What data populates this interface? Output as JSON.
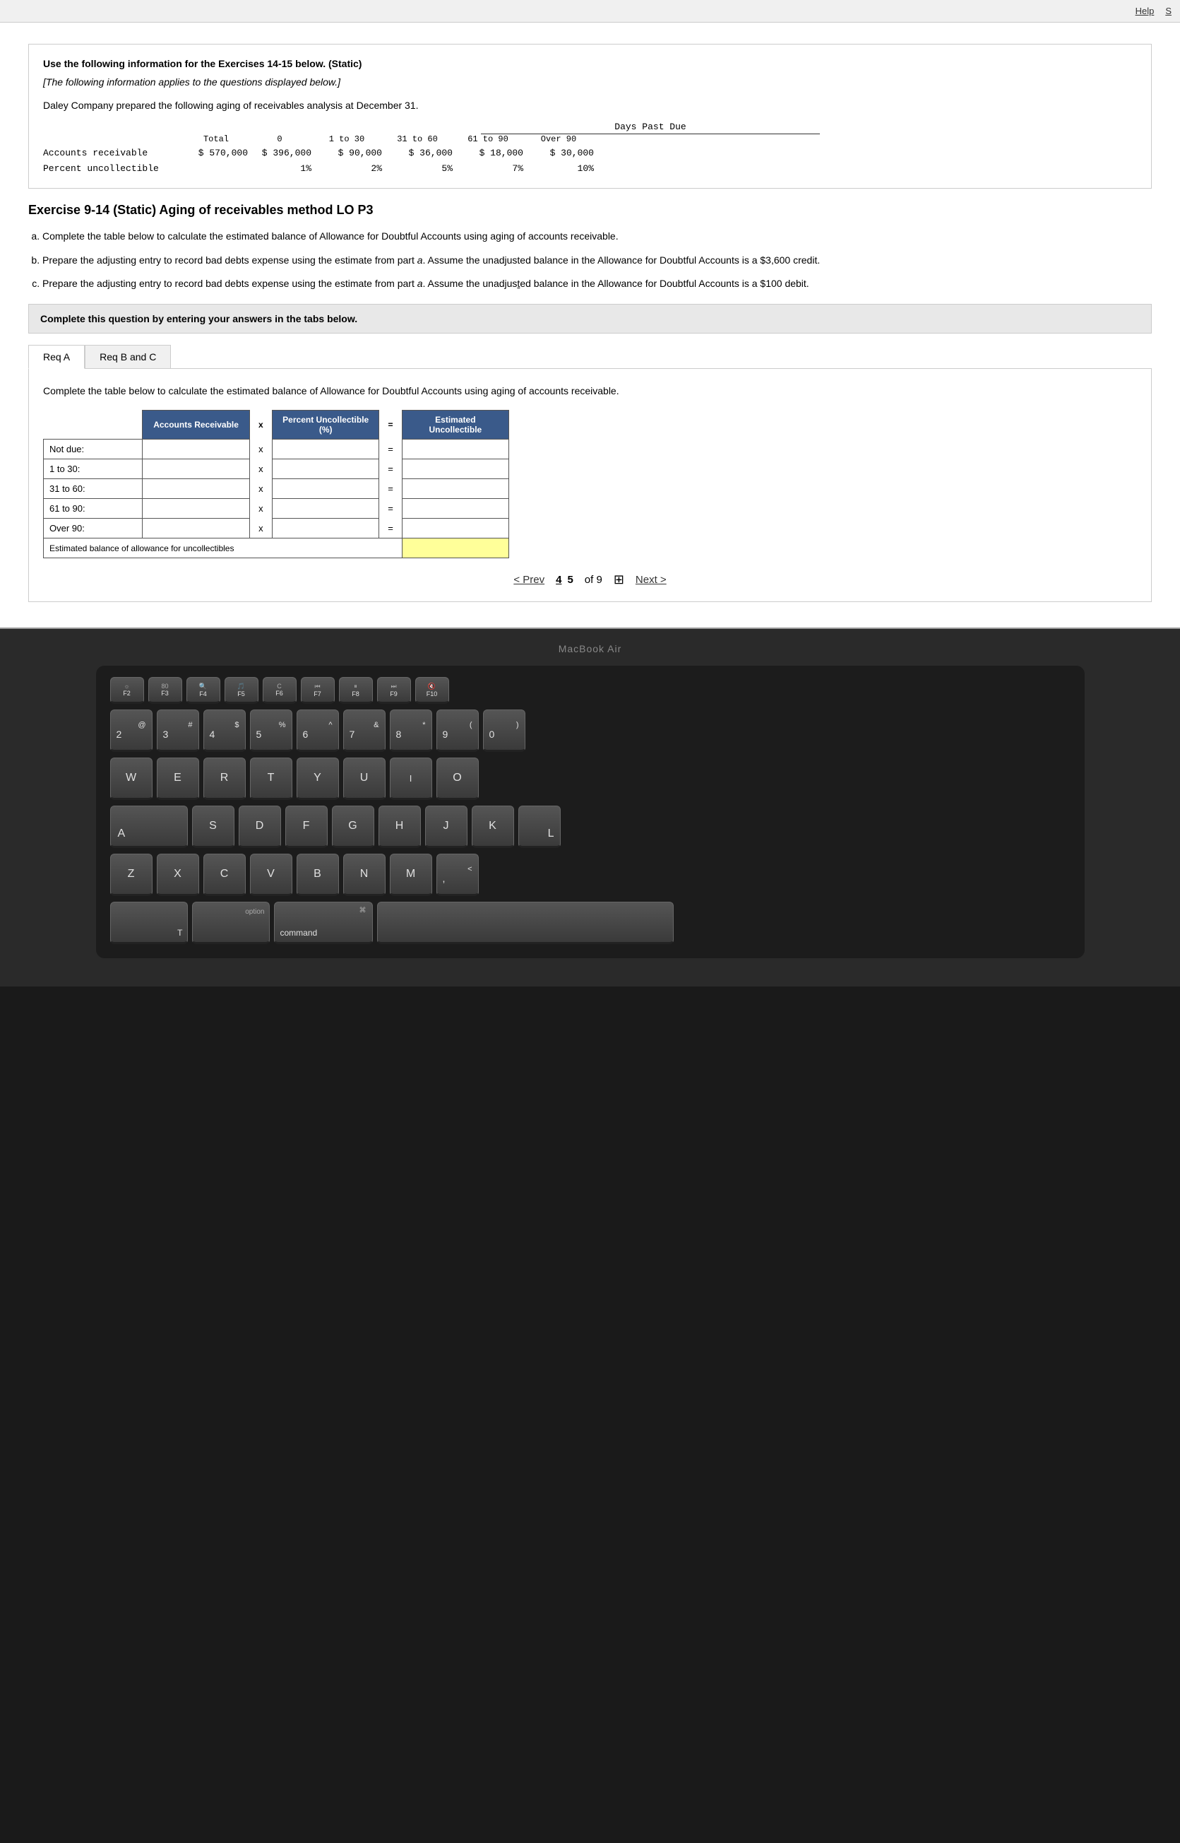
{
  "topbar": {
    "help_label": "Help",
    "s_label": "S"
  },
  "info_block": {
    "title": "Use the following information for the Exercises 14-15 below. (Static)",
    "subtitle": "[The following information applies to the questions displayed below.]",
    "description": "Daley Company prepared the following aging of receivables analysis at December 31.",
    "table": {
      "header": {
        "days_past_due": "Days Past Due",
        "total_label": "Total",
        "col0": "0",
        "col1": "1 to 30",
        "col2": "31 to 60",
        "col3": "61 to 90",
        "col4": "Over 90"
      },
      "row1_label": "Accounts receivable",
      "row1_total": "$ 570,000",
      "row1_0": "$ 396,000",
      "row1_1": "$ 90,000",
      "row1_2": "$ 36,000",
      "row1_3": "$ 18,000",
      "row1_4": "$ 30,000",
      "row2_label": "Percent uncollectible",
      "row2_0": "1%",
      "row2_1": "2%",
      "row2_2": "5%",
      "row2_3": "7%",
      "row2_4": "10%"
    }
  },
  "exercise": {
    "title": "Exercise 9-14 (Static) Aging of receivables method LO P3",
    "instructions": [
      "a. Complete the table below to calculate the estimated balance of Allowance for Doubtful Accounts using aging of accounts receivable.",
      "b. Prepare the adjusting entry to record bad debts expense using the estimate from part a. Assume the unadjusted balance in the Allowance for Doubtful Accounts is a $3,600 credit.",
      "c. Prepare the adjusting entry to record bad debts expense using the estimate from part a. Assume the unadjusted balance in the Allowance for Doubtful Accounts is a $100 debit."
    ],
    "complete_notice": "Complete this question by entering your answers in the tabs below.",
    "tabs": [
      {
        "label": "Req A",
        "active": true
      },
      {
        "label": "Req B and C",
        "active": false
      }
    ],
    "panel_intro": "Complete the table below to calculate the estimated balance of Allowance for Doubtful Accounts using aging of accounts receivable.",
    "table": {
      "headers": [
        "Accounts Receivable",
        "x",
        "Percent Uncollectible (%)",
        "=",
        "Estimated Uncollectible"
      ],
      "rows": [
        {
          "label": "Not due:",
          "accounts_receivable": "",
          "percent": "",
          "estimated": ""
        },
        {
          "label": "1 to 30:",
          "accounts_receivable": "",
          "percent": "",
          "estimated": ""
        },
        {
          "label": "31 to 60:",
          "accounts_receivable": "",
          "percent": "",
          "estimated": ""
        },
        {
          "label": "61 to 90:",
          "accounts_receivable": "",
          "percent": "",
          "estimated": ""
        },
        {
          "label": "Over 90:",
          "accounts_receivable": "",
          "percent": "",
          "estimated": ""
        }
      ],
      "footer_label": "Estimated balance of allowance for uncollectibles"
    }
  },
  "pagination": {
    "prev_label": "< Prev",
    "next_label": "Next >",
    "current_pages": "4  5",
    "of_label": "of 9"
  },
  "macbook_label": "MacBook Air",
  "keyboard": {
    "fn_row": [
      "F2",
      "F3 80",
      "F4 q",
      "F5 ♪",
      "F6 C",
      "F7 ◁◁",
      "F8 ▮▮",
      "F9 ▷▷",
      "F10 q"
    ],
    "row1": [
      {
        "top": "@",
        "bottom": "2"
      },
      {
        "top": "#",
        "bottom": "3"
      },
      {
        "top": "$",
        "bottom": "4"
      },
      {
        "top": "%",
        "bottom": "5"
      },
      {
        "top": "^",
        "bottom": "6"
      },
      {
        "top": "&",
        "bottom": "7"
      },
      {
        "top": "*",
        "bottom": "8"
      },
      {
        "top": "(",
        "bottom": "9"
      },
      {
        "top": ")",
        "bottom": "0"
      }
    ],
    "row_letters1": [
      "W",
      "E",
      "R",
      "T",
      "Y",
      "U",
      "I",
      "O"
    ],
    "row_letters2": [
      "S",
      "D",
      "F",
      "G",
      "H",
      "J",
      "K",
      "L"
    ],
    "row_letters3": [
      "Z",
      "X",
      "C",
      "V",
      "B",
      "N",
      "M"
    ],
    "bottom_row": {
      "option": "option",
      "command": "command"
    }
  }
}
